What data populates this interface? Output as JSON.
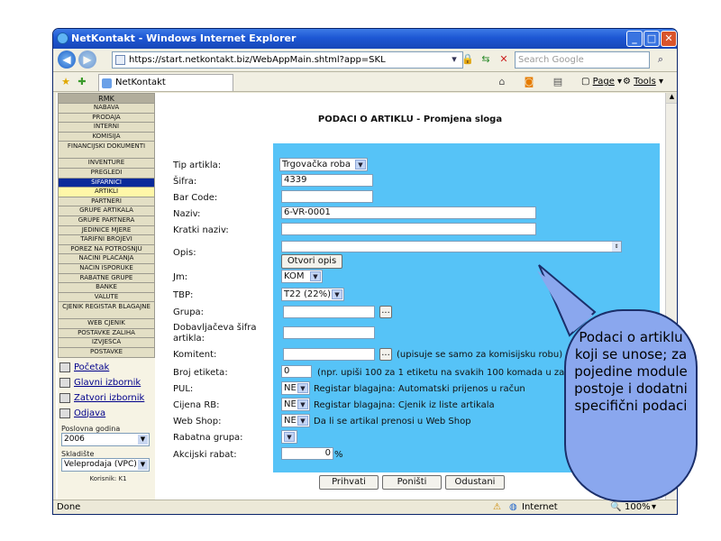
{
  "window": {
    "title": "NetKontakt - Windows Internet Explorer"
  },
  "address_bar": {
    "url": "https://start.netkontakt.biz/WebAppMain.shtml?app=SKL",
    "search_placeholder": "Search Google"
  },
  "tab": {
    "label": "NetKontakt"
  },
  "toolbar": {
    "page_label": "Page",
    "tools_label": "Tools"
  },
  "sidebar": {
    "menu": [
      {
        "label": "RMK",
        "kind": "head"
      },
      {
        "label": "NABAVA"
      },
      {
        "label": "PRODAJA"
      },
      {
        "label": "INTERNI"
      },
      {
        "label": "KOMISIJA"
      },
      {
        "label": "FINANCIJSKI DOKUMENTI",
        "kind": "two"
      },
      {
        "label": "INVENTURE"
      },
      {
        "label": "PREGLEDI"
      },
      {
        "label": "ŠIFARNICI",
        "kind": "selected"
      },
      {
        "label": "ARTIKLI",
        "kind": "active"
      },
      {
        "label": "PARTNERI"
      },
      {
        "label": "GRUPE ARTIKALA"
      },
      {
        "label": "GRUPE PARTNERA"
      },
      {
        "label": "JEDINICE MJERE"
      },
      {
        "label": "TARIFNI BROJEVI"
      },
      {
        "label": "POREZ NA POTROŠNJU"
      },
      {
        "label": "NAČINI PLAĆANJA"
      },
      {
        "label": "NAČIN ISPORUKE"
      },
      {
        "label": "RABATNE GRUPE"
      },
      {
        "label": "BANKE"
      },
      {
        "label": "VALUTE"
      },
      {
        "label": "CJENIK REGISTAR BLAGAJNE",
        "kind": "two"
      },
      {
        "label": "WEB CJENIK"
      },
      {
        "label": "POSTAVKE ZALIHA"
      },
      {
        "label": "IZVJEŠĆA"
      },
      {
        "label": "POSTAVKE"
      }
    ],
    "links": [
      "Početak",
      "Glavni izbornik",
      "Zatvori izbornik",
      "Odjava"
    ],
    "year_label": "Poslovna godina",
    "year_value": "2006",
    "warehouse_label": "Skladište",
    "warehouse_value": "Veleprodaja (VPC)",
    "user_label": "Korisnik: K1"
  },
  "form": {
    "title": "PODACI O ARTIKLU - Promjena sloga",
    "fields": {
      "tip_label": "Tip artikla:",
      "tip_value": "Trgovačka roba",
      "sifra_label": "Šifra:",
      "sifra_value": "4339",
      "barcode_label": "Bar Code:",
      "barcode_value": "",
      "naziv_label": "Naziv:",
      "naziv_value": "6-VR-0001",
      "kratki_label": "Kratki naziv:",
      "kratki_value": "",
      "opis_label": "Opis:",
      "opis_button": "Otvori opis",
      "jm_label": "Jm:",
      "jm_value": "KOM",
      "tbp_label": "TBP:",
      "tbp_value": "T22 (22%)",
      "grupa_label": "Grupa:",
      "grupa_button": "...",
      "dobavljac_label": "Dobavljačeva šifra artikla:",
      "komitent_label": "Komitent:",
      "komitent_button": "...",
      "komitent_hint": "(upisuje se samo za komisijsku robu)",
      "etiketa_label": "Broj etiketa:",
      "etiketa_value": "0",
      "etiketa_hint": "(npr. upiši 100 za 1 etiketu na svakih 100 komada u zadnjoj)",
      "pul_label": "PUL:",
      "pul_value": "NE",
      "pul_hint": "Registar blagajna: Automatski prijenos u račun",
      "cijena_label": "Cijena RB:",
      "cijena_value": "NE",
      "cijena_hint": "Registar blagajna: Cjenik iz liste artikala",
      "webshop_label": "Web Shop:",
      "webshop_value": "NE",
      "webshop_hint": "Da li se artikal prenosi u Web Shop",
      "rabatna_label": "Rabatna grupa:",
      "akcijski_label": "Akcijski rabat:",
      "akcijski_value": "0",
      "akcijski_unit": "%"
    },
    "buttons": {
      "save": "Prihvati",
      "cancel": "Poništi",
      "quit": "Odustani"
    }
  },
  "status": {
    "left": "Done",
    "zone": "Internet",
    "zoom": "100%"
  },
  "callout": {
    "text": "Podaci o artiklu koji se unose; za pojedine module postoje i dodatni specifični podaci"
  }
}
